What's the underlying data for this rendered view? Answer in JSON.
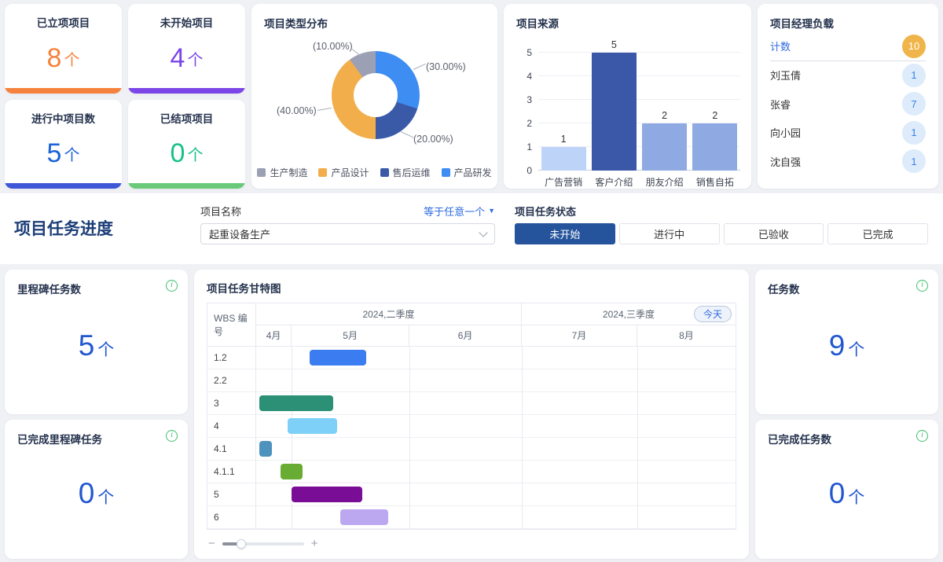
{
  "stat_cards": [
    {
      "label": "已立项项目",
      "value": "8",
      "suffix": "个",
      "num_color": "#F5823C",
      "bar_color": "#F5823C"
    },
    {
      "label": "未开始项目",
      "value": "4",
      "suffix": "个",
      "num_color": "#7B45E7",
      "bar_color": "#7B45E7"
    },
    {
      "label": "进行中项目数",
      "value": "5",
      "suffix": "个",
      "num_color": "#1B63D6",
      "bar_color": "#3D57D6"
    },
    {
      "label": "已结项项目",
      "value": "0",
      "suffix": "个",
      "num_color": "#16C28A",
      "bar_color": "#6BC97A"
    }
  ],
  "chart_data": [
    {
      "id": "project_type",
      "type": "pie",
      "title": "项目类型分布",
      "donut": true,
      "labels": [
        "生产制造",
        "产品设计",
        "售后运维",
        "产品研发"
      ],
      "values": [
        10,
        40,
        20,
        30
      ],
      "colors": [
        "#9CA0B4",
        "#F1AE4B",
        "#3A5AA8",
        "#3E8DF2"
      ],
      "annotations": [
        "(10.00%)",
        "(40.00%)",
        "(20.00%)",
        "(30.00%)"
      ],
      "draw_order": [
        3,
        2,
        1,
        0
      ],
      "legend_position": "bottom"
    },
    {
      "id": "project_source",
      "type": "bar",
      "title": "项目来源",
      "categories": [
        "广告营销",
        "客户介绍",
        "朋友介绍",
        "销售自拓"
      ],
      "values": [
        1,
        5,
        2,
        2
      ],
      "colors": [
        "#BDD3F8",
        "#3A57A8",
        "#8FA9E2",
        "#8FA9E2"
      ],
      "ylim": [
        0,
        5
      ],
      "yticks": [
        0,
        1,
        2,
        3,
        4,
        5
      ],
      "grid": true
    },
    {
      "id": "task_gantt",
      "type": "gantt",
      "title": "项目任务甘特图",
      "wbs_header": "WBS 编号",
      "today_label": "今天",
      "quarters": [
        {
          "label": "2024,二季度",
          "months": 3
        },
        {
          "label": "2024,三季度",
          "months": 2
        }
      ],
      "months": [
        {
          "label": "4月",
          "width_pct": 7.4
        },
        {
          "label": "5月",
          "width_pct": 24.6
        },
        {
          "label": "6月",
          "width_pct": 23.4
        },
        {
          "label": "7月",
          "width_pct": 24.1
        },
        {
          "label": "8月",
          "width_pct": 20.5
        }
      ],
      "rows": [
        {
          "wbs": "1.2",
          "bar": {
            "start_pct": 11.2,
            "width_pct": 11.7,
            "color": "#3B7CF0"
          }
        },
        {
          "wbs": "2.2",
          "bar": null
        },
        {
          "wbs": "3",
          "bar": {
            "start_pct": 0.6,
            "width_pct": 15.4,
            "color": "#2B9076"
          }
        },
        {
          "wbs": "4",
          "bar": {
            "start_pct": 6.6,
            "width_pct": 10.3,
            "color": "#7ED0F8"
          }
        },
        {
          "wbs": "4.1",
          "bar": {
            "start_pct": 0.6,
            "width_pct": 2.7,
            "color": "#4E92BE"
          }
        },
        {
          "wbs": "4.1.1",
          "bar": {
            "start_pct": 5.0,
            "width_pct": 4.7,
            "color": "#69AC34"
          }
        },
        {
          "wbs": "5",
          "bar": {
            "start_pct": 7.4,
            "width_pct": 14.8,
            "color": "#7A0D96"
          }
        },
        {
          "wbs": "6",
          "bar": {
            "start_pct": 17.5,
            "width_pct": 10.1,
            "color": "#BBA8F0"
          }
        }
      ],
      "zoom_out_glyph": "−",
      "zoom_in_glyph": "+"
    }
  ],
  "manager_panel": {
    "title": "项目经理负载",
    "rows": [
      {
        "name": "计数",
        "count": "10",
        "header": true
      },
      {
        "name": "刘玉倩",
        "count": "1"
      },
      {
        "name": "张睿",
        "count": "7"
      },
      {
        "name": "向小园",
        "count": "1"
      },
      {
        "name": "沈自强",
        "count": "1"
      }
    ],
    "header_badge_bg": "#F0B54A",
    "header_badge_text": "#FFFFFF",
    "badge_bg": "#DDEBFB",
    "badge_text": "#3B82E8"
  },
  "filters": {
    "section_title": "项目任务进度",
    "project_name_label": "项目名称",
    "operator_label": "等于任意一个",
    "operator_arrow": "▼",
    "project_select_value": "起重设备生产",
    "status_label": "项目任务状态",
    "status_options": [
      "未开始",
      "进行中",
      "已验收",
      "已完成"
    ],
    "status_active_index": 0,
    "active_color": "#26549C"
  },
  "metric_cards": [
    {
      "label": "里程碑任务数",
      "value": "5",
      "suffix": "个"
    },
    {
      "label": "已完成里程碑任务",
      "value": "0",
      "suffix": "个"
    },
    {
      "label": "任务数",
      "value": "9",
      "suffix": "个"
    },
    {
      "label": "已完成任务数",
      "value": "0",
      "suffix": "个"
    }
  ]
}
